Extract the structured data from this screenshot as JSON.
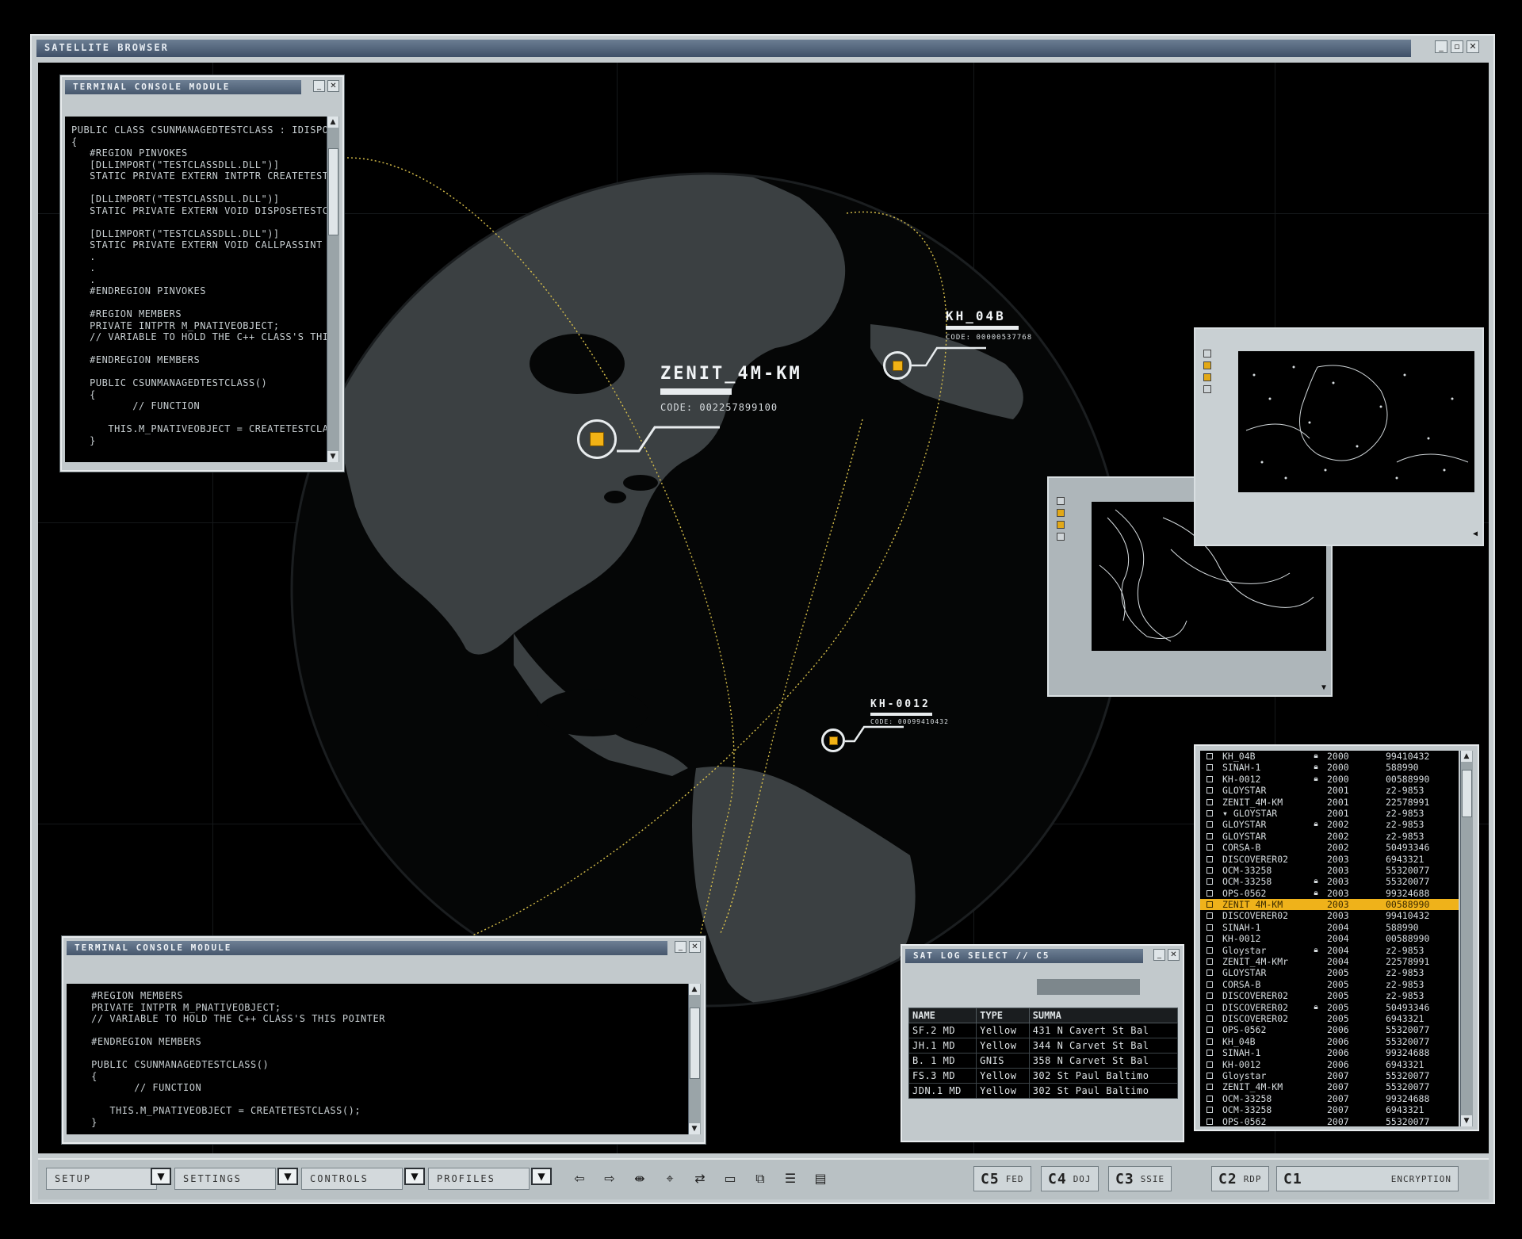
{
  "app": {
    "title": "SATELLITE BROWSER"
  },
  "console_top": {
    "title": "TERMINAL CONSOLE MODULE",
    "code": "PUBLIC CLASS CSUNMANAGEDTESTCLASS : IDISPOSABLE\n{\n   #REGION PINVOKES\n   [DLLIMPORT(\"TESTCLASSDLL.DLL\")]\n   STATIC PRIVATE EXTERN INTPTR CREATETESTCLASS();\n\n   [DLLIMPORT(\"TESTCLASSDLL.DLL\")]\n   STATIC PRIVATE EXTERN VOID DISPOSETESTCLASS\n\n   [DLLIMPORT(\"TESTCLASSDLL.DLL\")]\n   STATIC PRIVATE EXTERN VOID CALLPASSINT\n   .\n   .\n   .\n   #ENDREGION PINVOKES\n\n   #REGION MEMBERS\n   PRIVATE INTPTR M_PNATIVEOBJECT;\n   // VARIABLE TO HOLD THE C++ CLASS'S THIS\n\n   #ENDREGION MEMBERS\n\n   PUBLIC CSUNMANAGEDTESTCLASS()\n   {\n          // FUNCTION\n\n      THIS.M_PNATIVEOBJECT = CREATETESTCLASS();\n   }"
  },
  "console_bottom": {
    "title": "TERMINAL CONSOLE MODULE",
    "code": "   #REGION MEMBERS\n   PRIVATE INTPTR M_PNATIVEOBJECT;\n   // VARIABLE TO HOLD THE C++ CLASS'S THIS POINTER\n\n   #ENDREGION MEMBERS\n\n   PUBLIC CSUNMANAGEDTESTCLASS()\n   {\n          // FUNCTION\n\n      THIS.M_PNATIVEOBJECT = CREATETESTCLASS();\n   }"
  },
  "satellites": {
    "zenit": {
      "name": "ZENIT_4M-KM",
      "code": "CODE: 002257899100"
    },
    "kh04b": {
      "name": "KH_04B",
      "code": "CODE: 00000537768"
    },
    "kh0012": {
      "name": "KH-0012",
      "code": "CODE: 00099410432"
    }
  },
  "sat_list": [
    {
      "name": "KH_04B",
      "locked": true,
      "year": "2000",
      "code": "99410432"
    },
    {
      "name": "SINAH-1",
      "locked": true,
      "year": "2000",
      "code": "588990"
    },
    {
      "name": "KH-0012",
      "locked": true,
      "year": "2000",
      "code": "00588990"
    },
    {
      "name": "GLOYSTAR",
      "locked": false,
      "year": "2001",
      "code": "z2-9853"
    },
    {
      "name": "ZENIT_4M-KM",
      "locked": false,
      "year": "2001",
      "code": "22578991"
    },
    {
      "name": "▾ GLOYSTAR",
      "locked": false,
      "year": "2001",
      "code": "z2-9853"
    },
    {
      "name": "GLOYSTAR",
      "locked": true,
      "year": "2002",
      "code": "z2-9853"
    },
    {
      "name": "GLOYSTAR",
      "locked": false,
      "year": "2002",
      "code": "z2-9853"
    },
    {
      "name": "CORSA-B",
      "locked": false,
      "year": "2002",
      "code": "50493346"
    },
    {
      "name": "DISCOVERER02",
      "locked": false,
      "year": "2003",
      "code": "6943321"
    },
    {
      "name": "OCM-33258",
      "locked": false,
      "year": "2003",
      "code": "55320077"
    },
    {
      "name": "OCM-33258",
      "locked": true,
      "year": "2003",
      "code": "55320077"
    },
    {
      "name": "OPS-0562",
      "locked": true,
      "year": "2003",
      "code": "99324688"
    },
    {
      "name": "ZENIT 4M-KM",
      "locked": false,
      "year": "2003",
      "code": "00588990",
      "selected": true
    },
    {
      "name": "DISCOVERER02",
      "locked": false,
      "year": "2003",
      "code": "99410432"
    },
    {
      "name": "SINAH-1",
      "locked": false,
      "year": "2004",
      "code": "588990"
    },
    {
      "name": "KH-0012",
      "locked": false,
      "year": "2004",
      "code": "00588990"
    },
    {
      "name": "Gloystar",
      "locked": true,
      "year": "2004",
      "code": "z2-9853"
    },
    {
      "name": "ZENIT_4M-KMr",
      "locked": false,
      "year": "2004",
      "code": "22578991"
    },
    {
      "name": "GLOYSTAR",
      "locked": false,
      "year": "2005",
      "code": "z2-9853"
    },
    {
      "name": "CORSA-B",
      "locked": false,
      "year": "2005",
      "code": "z2-9853"
    },
    {
      "name": "DISCOVERER02",
      "locked": false,
      "year": "2005",
      "code": "z2-9853"
    },
    {
      "name": "DISCOVERER02",
      "locked": true,
      "year": "2005",
      "code": "50493346"
    },
    {
      "name": "DISCOVERER02",
      "locked": false,
      "year": "2005",
      "code": "6943321"
    },
    {
      "name": "OPS-0562",
      "locked": false,
      "year": "2006",
      "code": "55320077"
    },
    {
      "name": "KH_04B",
      "locked": false,
      "year": "2006",
      "code": "55320077"
    },
    {
      "name": "SINAH-1",
      "locked": false,
      "year": "2006",
      "code": "99324688"
    },
    {
      "name": "KH-0012",
      "locked": false,
      "year": "2006",
      "code": "6943321"
    },
    {
      "name": "Gloystar",
      "locked": false,
      "year": "2007",
      "code": "55320077"
    },
    {
      "name": "ZENIT_4M-KM",
      "locked": false,
      "year": "2007",
      "code": "55320077"
    },
    {
      "name": "OCM-33258",
      "locked": false,
      "year": "2007",
      "code": "99324688"
    },
    {
      "name": "OCM-33258",
      "locked": false,
      "year": "2007",
      "code": "6943321"
    },
    {
      "name": "OPS-0562",
      "locked": false,
      "year": "2007",
      "code": "55320077"
    }
  ],
  "sat_log": {
    "title": "SAT LOG SELECT // C5",
    "headers": [
      "NAME",
      "TYPE",
      "SUMMA"
    ],
    "rows": [
      [
        "SF.2 MD",
        "Yellow",
        "431 N Cavert St Bal"
      ],
      [
        "JH.1 MD",
        "Yellow",
        "344 N Carvet St Bal"
      ],
      [
        "B. 1 MD",
        "GNIS",
        "358 N Carvet St Bal"
      ],
      [
        "FS.3 MD",
        "Yellow",
        "302 St Paul Baltimo"
      ],
      [
        "JDN.1 MD",
        "Yellow",
        "302 St Paul Baltimo"
      ]
    ]
  },
  "toolbar": {
    "menus": [
      "SETUP",
      "SETTINGS",
      "CONTROLS",
      "PROFILES"
    ],
    "channels": [
      {
        "id": "C5",
        "label": "FED"
      },
      {
        "id": "C4",
        "label": "DOJ"
      },
      {
        "id": "C3",
        "label": "SSIE"
      },
      {
        "id": "C2",
        "label": "RDP"
      },
      {
        "id": "C1",
        "label": "ENCRYPTION"
      }
    ]
  },
  "colors": {
    "accent": "#f2b215",
    "chrome": "#c2c9cc",
    "titlebar": "#46576d",
    "land": "#3b4042"
  }
}
